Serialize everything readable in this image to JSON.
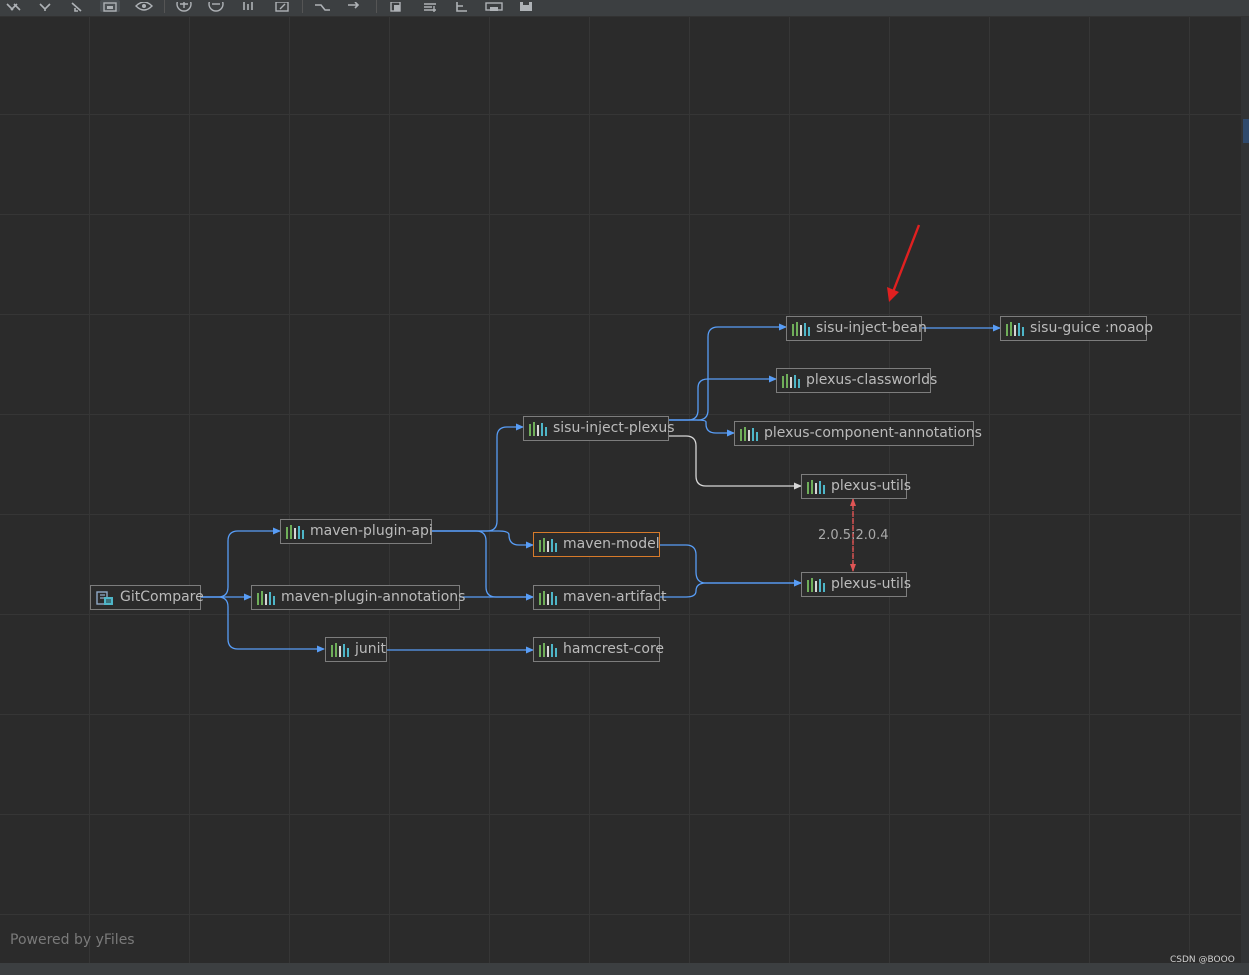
{
  "toolbar": {
    "buttons": [
      {
        "name": "toggle-icon"
      },
      {
        "name": "fit-content-icon"
      },
      {
        "name": "actual-size-icon"
      },
      {
        "name": "layout-icon"
      },
      {
        "name": "show-conflicts-icon"
      },
      {
        "name": "zoom-in-icon"
      },
      {
        "name": "zoom-out-icon"
      },
      {
        "name": "hierarchic-layout-icon"
      },
      {
        "name": "export-icon"
      },
      {
        "name": "collapse-icon"
      },
      {
        "name": "navigate-icon"
      },
      {
        "name": "copy-icon"
      },
      {
        "name": "align-icon"
      },
      {
        "name": "group-icon"
      },
      {
        "name": "print-icon"
      },
      {
        "name": "save-icon"
      }
    ]
  },
  "diagram": {
    "root": {
      "label": "GitCompare",
      "icon": "module-icon"
    },
    "nodes": [
      {
        "id": "maven-plugin-api",
        "label": "maven-plugin-api"
      },
      {
        "id": "maven-plugin-annotations",
        "label": "maven-plugin-annotations"
      },
      {
        "id": "junit",
        "label": "junit"
      },
      {
        "id": "sisu-inject-plexus",
        "label": "sisu-inject-plexus"
      },
      {
        "id": "maven-model",
        "label": "maven-model"
      },
      {
        "id": "maven-artifact",
        "label": "maven-artifact"
      },
      {
        "id": "hamcrest-core",
        "label": "hamcrest-core"
      },
      {
        "id": "sisu-inject-bean",
        "label": "sisu-inject-bean"
      },
      {
        "id": "sisu-guice",
        "label": "sisu-guice :noaop"
      },
      {
        "id": "plexus-classworlds",
        "label": "plexus-classworlds"
      },
      {
        "id": "plexus-component-annotations",
        "label": "plexus-component-annotations"
      },
      {
        "id": "plexus-utils-a",
        "label": "plexus-utils"
      },
      {
        "id": "plexus-utils-b",
        "label": "plexus-utils"
      }
    ],
    "conflict_label": "2.0.5:2.0.4",
    "highlighted_node": "maven-model",
    "colors": {
      "edge": "#589df6",
      "edge_alt": "#d6d6d6",
      "conflict": "#e05555",
      "annotation_arrow": "#e02020",
      "highlight_border": "#d77a2a",
      "node_border": "#7d7d7d"
    }
  },
  "footer": {
    "powered_by": "Powered by yFiles"
  },
  "watermark": "CSDN @BOOO"
}
